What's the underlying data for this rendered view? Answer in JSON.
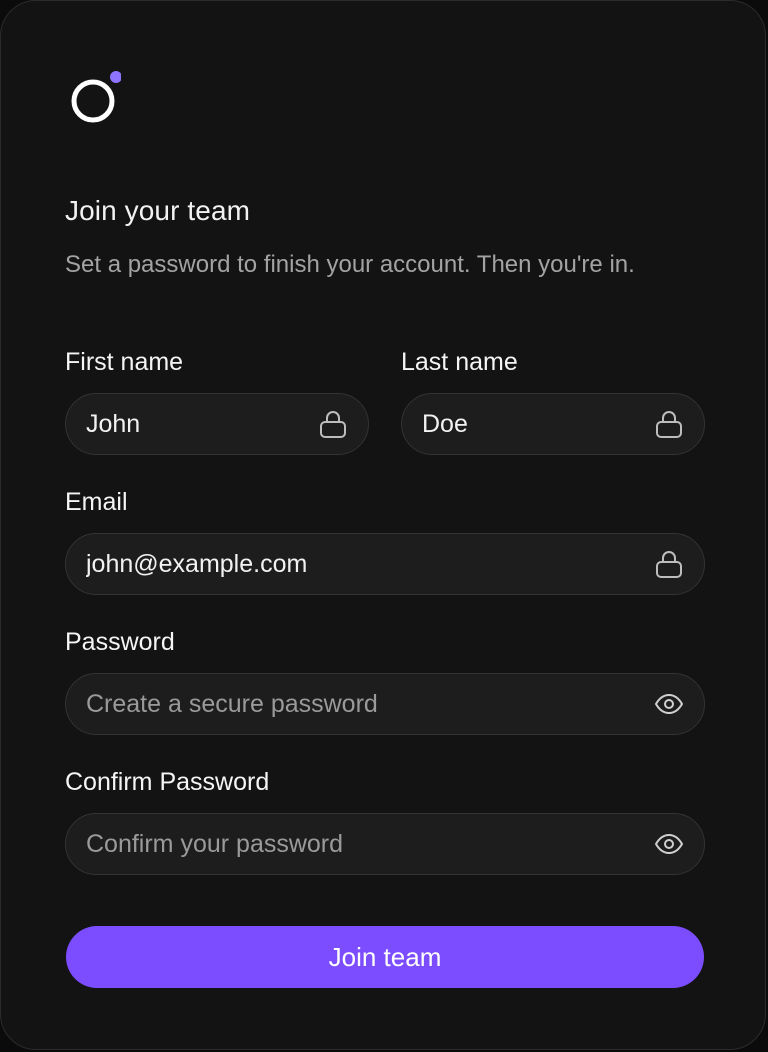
{
  "brand": {
    "logo_icon": "ring-logo-icon",
    "accent_color": "#7c4dff"
  },
  "header": {
    "title": "Join your team",
    "subtitle": "Set a password to finish your account. Then you're in."
  },
  "form": {
    "first_name": {
      "label": "First name",
      "value": "John",
      "icon": "lock-icon"
    },
    "last_name": {
      "label": "Last name",
      "value": "Doe",
      "icon": "lock-icon"
    },
    "email": {
      "label": "Email",
      "value": "john@example.com",
      "icon": "lock-icon"
    },
    "password": {
      "label": "Password",
      "placeholder": "Create a secure password",
      "icon": "eye-icon"
    },
    "confirm_password": {
      "label": "Confirm Password",
      "placeholder": "Confirm your password",
      "icon": "eye-icon"
    },
    "submit_label": "Join team"
  }
}
